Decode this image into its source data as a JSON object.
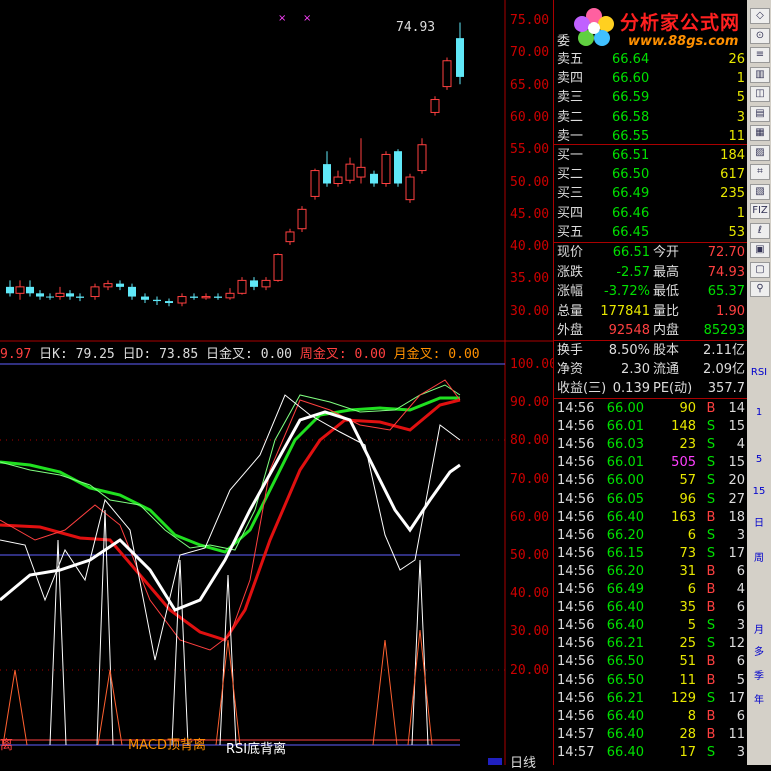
{
  "colors": {
    "red": "#ff4040",
    "green": "#00e000",
    "yellow": "#e8e800",
    "cyan": "#60e8f8",
    "magenta": "#ff40ff",
    "white": "#ffffff"
  },
  "price_chart": {
    "max_label": "74.93",
    "y_ticks": [
      "75.00",
      "70.00",
      "65.00",
      "60.00",
      "55.00",
      "50.00",
      "45.00",
      "40.00",
      "35.00",
      "30.00"
    ]
  },
  "indicator_header": {
    "prefix": "9.97",
    "k_text": "日K: 79.25",
    "d_text": "日D: 73.85",
    "jincha_text": "日金叉: 0.00",
    "zhou_text": "周金叉: 0.00",
    "yue_text": "月金叉: 0.00"
  },
  "indicator_ticks": [
    "100.00",
    "90.00",
    "80.00",
    "70.00",
    "60.00",
    "50.00",
    "40.00",
    "30.00",
    "20.00"
  ],
  "signals": {
    "macd": "MACD顶背离",
    "rsi": "RSI底背离",
    "left": "离"
  },
  "bottom_label": "日线",
  "quote": {
    "asks": [
      {
        "label": "卖五",
        "price": "66.64",
        "vol": "26"
      },
      {
        "label": "卖四",
        "price": "66.60",
        "vol": "1"
      },
      {
        "label": "卖三",
        "price": "66.59",
        "vol": "5"
      },
      {
        "label": "卖二",
        "price": "66.58",
        "vol": "3"
      },
      {
        "label": "卖一",
        "price": "66.55",
        "vol": "11"
      }
    ],
    "bids": [
      {
        "label": "买一",
        "price": "66.51",
        "vol": "184"
      },
      {
        "label": "买二",
        "price": "66.50",
        "vol": "617"
      },
      {
        "label": "买三",
        "price": "66.49",
        "vol": "235"
      },
      {
        "label": "买四",
        "price": "66.46",
        "vol": "1"
      },
      {
        "label": "买五",
        "price": "66.45",
        "vol": "53"
      }
    ],
    "weibi_label": "委",
    "stats": [
      {
        "l1": "现价",
        "v1": "66.51",
        "c1": "#00e000",
        "l2": "今开",
        "v2": "72.70",
        "c2": "#ff4040"
      },
      {
        "l1": "涨跌",
        "v1": "-2.57",
        "c1": "#00e000",
        "l2": "最高",
        "v2": "74.93",
        "c2": "#ff4040"
      },
      {
        "l1": "涨幅",
        "v1": "-3.72%",
        "c1": "#00e000",
        "l2": "最低",
        "v2": "65.37",
        "c2": "#00e000"
      },
      {
        "l1": "总量",
        "v1": "177841",
        "c1": "#e8e800",
        "l2": "量比",
        "v2": "1.90",
        "c2": "#ff4040"
      },
      {
        "l1": "外盘",
        "v1": "92548",
        "c1": "#ff4040",
        "l2": "内盘",
        "v2": "85293",
        "c2": "#00e000"
      }
    ],
    "stats2": [
      {
        "l1": "换手",
        "v1": "8.50%",
        "l2": "股本",
        "v2": "2.11亿"
      },
      {
        "l1": "净资",
        "v1": "2.30",
        "l2": "流通",
        "v2": "2.09亿"
      },
      {
        "l1": "收益(三)",
        "v1": "0.139",
        "l2": "PE(动)",
        "v2": "357.7"
      }
    ]
  },
  "ticks": [
    {
      "time": "14:56",
      "price": "66.00",
      "vol": "90",
      "bs": "B",
      "n": "14"
    },
    {
      "time": "14:56",
      "price": "66.01",
      "vol": "148",
      "bs": "S",
      "n": "15"
    },
    {
      "time": "14:56",
      "price": "66.03",
      "vol": "23",
      "bs": "S",
      "n": "4"
    },
    {
      "time": "14:56",
      "price": "66.01",
      "vol": "505",
      "bs": "S",
      "n": "15"
    },
    {
      "time": "14:56",
      "price": "66.00",
      "vol": "57",
      "bs": "S",
      "n": "20"
    },
    {
      "time": "14:56",
      "price": "66.05",
      "vol": "96",
      "bs": "S",
      "n": "27"
    },
    {
      "time": "14:56",
      "price": "66.40",
      "vol": "163",
      "bs": "B",
      "n": "18"
    },
    {
      "time": "14:56",
      "price": "66.20",
      "vol": "6",
      "bs": "S",
      "n": "3"
    },
    {
      "time": "14:56",
      "price": "66.15",
      "vol": "73",
      "bs": "S",
      "n": "17"
    },
    {
      "time": "14:56",
      "price": "66.20",
      "vol": "31",
      "bs": "B",
      "n": "6"
    },
    {
      "time": "14:56",
      "price": "66.49",
      "vol": "6",
      "bs": "B",
      "n": "4"
    },
    {
      "time": "14:56",
      "price": "66.40",
      "vol": "35",
      "bs": "B",
      "n": "6"
    },
    {
      "time": "14:56",
      "price": "66.40",
      "vol": "5",
      "bs": "S",
      "n": "3"
    },
    {
      "time": "14:56",
      "price": "66.21",
      "vol": "25",
      "bs": "S",
      "n": "12"
    },
    {
      "time": "14:56",
      "price": "66.50",
      "vol": "51",
      "bs": "B",
      "n": "6"
    },
    {
      "time": "14:56",
      "price": "66.50",
      "vol": "11",
      "bs": "B",
      "n": "5"
    },
    {
      "time": "14:56",
      "price": "66.21",
      "vol": "129",
      "bs": "S",
      "n": "17"
    },
    {
      "time": "14:56",
      "price": "66.40",
      "vol": "8",
      "bs": "B",
      "n": "6"
    },
    {
      "time": "14:57",
      "price": "66.40",
      "vol": "28",
      "bs": "B",
      "n": "11"
    },
    {
      "time": "14:57",
      "price": "66.40",
      "vol": "17",
      "bs": "S",
      "n": "3"
    }
  ],
  "logo": {
    "name": "分析家公式网",
    "url": "www.88gs.com"
  },
  "toolbar": {
    "items": [
      "RSI",
      "1",
      "5",
      "15",
      "日",
      "周",
      "月",
      "多",
      "季",
      "年"
    ]
  }
}
